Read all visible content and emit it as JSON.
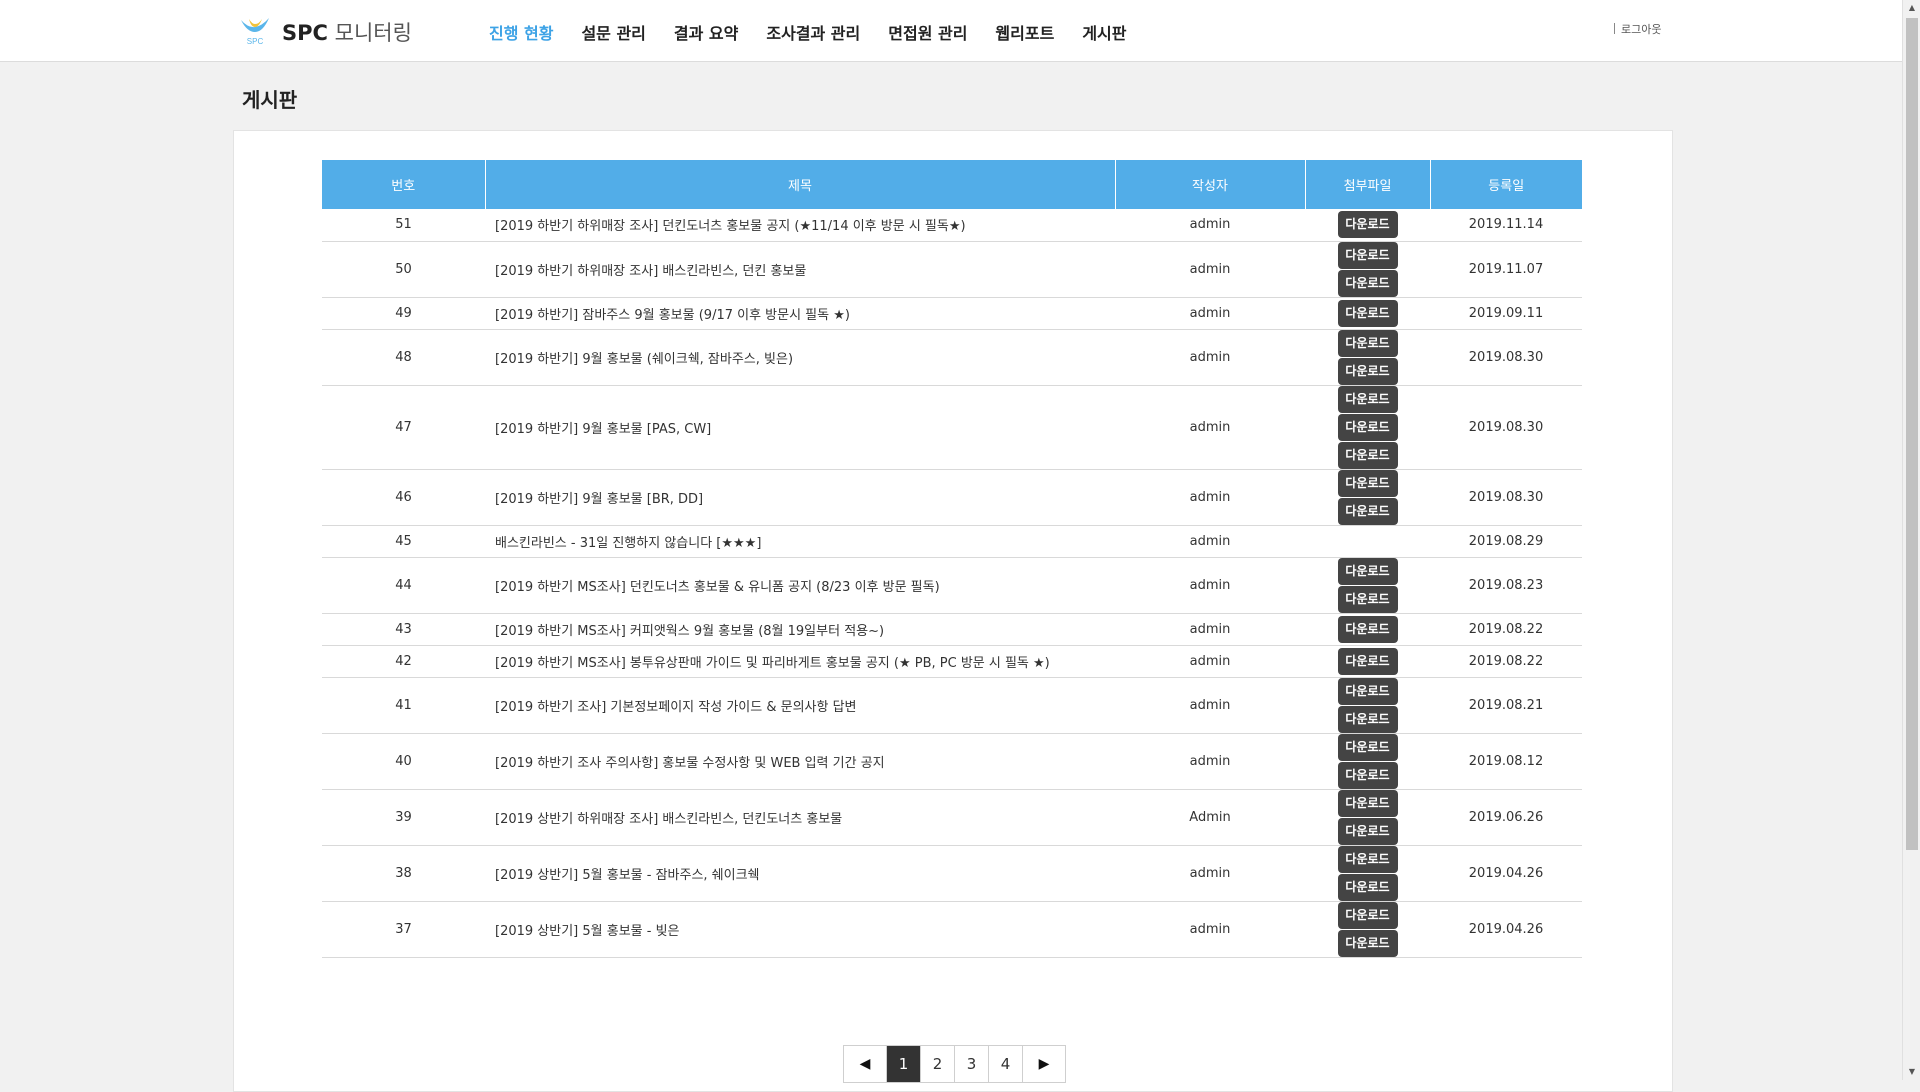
{
  "header": {
    "brand_bold": "SPC",
    "brand_rest": "모니터링",
    "logo_text": "SPC",
    "nav": [
      {
        "label": "진행 현황",
        "active": true
      },
      {
        "label": "설문 관리",
        "active": false
      },
      {
        "label": "결과 요약",
        "active": false
      },
      {
        "label": "조사결과 관리",
        "active": false
      },
      {
        "label": "면접원 관리",
        "active": false
      },
      {
        "label": "웹리포트",
        "active": false
      },
      {
        "label": "게시판",
        "active": false
      }
    ],
    "logout": "로그아웃"
  },
  "page_title": "게시판",
  "table": {
    "columns": [
      "번호",
      "제목",
      "작성자",
      "첨부파일",
      "등록일"
    ],
    "download_label": "다운로드",
    "rows": [
      {
        "no": "51",
        "title": "[2019 하반기 하위매장 조사] 던킨도너츠 홍보물 공지 (★11/14 이후 방문 시 필독★)",
        "author": "admin",
        "files": 1,
        "date": "2019.11.14"
      },
      {
        "no": "50",
        "title": "[2019 하반기 하위매장 조사] 배스킨라빈스, 던킨 홍보물",
        "author": "admin",
        "files": 2,
        "date": "2019.11.07"
      },
      {
        "no": "49",
        "title": "[2019 하반기] 잠바주스 9월 홍보물 (9/17 이후 방문시 필독 ★)",
        "author": "admin",
        "files": 1,
        "date": "2019.09.11"
      },
      {
        "no": "48",
        "title": "[2019 하반기] 9월 홍보물 (쉐이크쉑, 잠바주스, 빚은)",
        "author": "admin",
        "files": 2,
        "date": "2019.08.30"
      },
      {
        "no": "47",
        "title": "[2019 하반기] 9월 홍보물 [PAS, CW]",
        "author": "admin",
        "files": 3,
        "date": "2019.08.30"
      },
      {
        "no": "46",
        "title": "[2019 하반기] 9월 홍보물 [BR, DD]",
        "author": "admin",
        "files": 2,
        "date": "2019.08.30"
      },
      {
        "no": "45",
        "title": "배스킨라빈스 - 31일 진행하지 않습니다 [★★★]",
        "author": "admin",
        "files": 0,
        "date": "2019.08.29"
      },
      {
        "no": "44",
        "title": "[2019 하반기 MS조사] 던킨도너츠 홍보물 & 유니폼 공지 (8/23 이후 방문 필독)",
        "author": "admin",
        "files": 2,
        "date": "2019.08.23"
      },
      {
        "no": "43",
        "title": "[2019 하반기 MS조사] 커피앳웍스 9월 홍보물 (8월 19일부터 적용~)",
        "author": "admin",
        "files": 1,
        "date": "2019.08.22"
      },
      {
        "no": "42",
        "title": "[2019 하반기 MS조사] 봉투유상판매 가이드 및 파리바게트 홍보물 공지 (★ PB, PC 방문 시 필독 ★)",
        "author": "admin",
        "files": 1,
        "date": "2019.08.22"
      },
      {
        "no": "41",
        "title": "[2019 하반기 조사] 기본정보페이지 작성 가이드 & 문의사항 답변",
        "author": "admin",
        "files": 2,
        "date": "2019.08.21"
      },
      {
        "no": "40",
        "title": "[2019 하반기 조사 주의사항] 홍보물 수정사항 및 WEB 입력 기간 공지",
        "author": "admin",
        "files": 2,
        "date": "2019.08.12"
      },
      {
        "no": "39",
        "title": "[2019 상반기 하위매장 조사] 배스킨라빈스, 던킨도너츠 홍보물",
        "author": "Admin",
        "files": 2,
        "date": "2019.06.26"
      },
      {
        "no": "38",
        "title": "[2019 상반기] 5월 홍보물 - 잠바주스, 쉐이크쉑",
        "author": "admin",
        "files": 2,
        "date": "2019.04.26"
      },
      {
        "no": "37",
        "title": "[2019 상반기] 5월 홍보물 - 빚은",
        "author": "admin",
        "files": 2,
        "date": "2019.04.26"
      }
    ]
  },
  "pagination": {
    "prev": "◀",
    "next": "▶",
    "pages": [
      "1",
      "2",
      "3",
      "4"
    ],
    "current": "1"
  },
  "colors": {
    "accent": "#3ea3e6",
    "table_header": "#52ade8",
    "button": "#444444"
  }
}
